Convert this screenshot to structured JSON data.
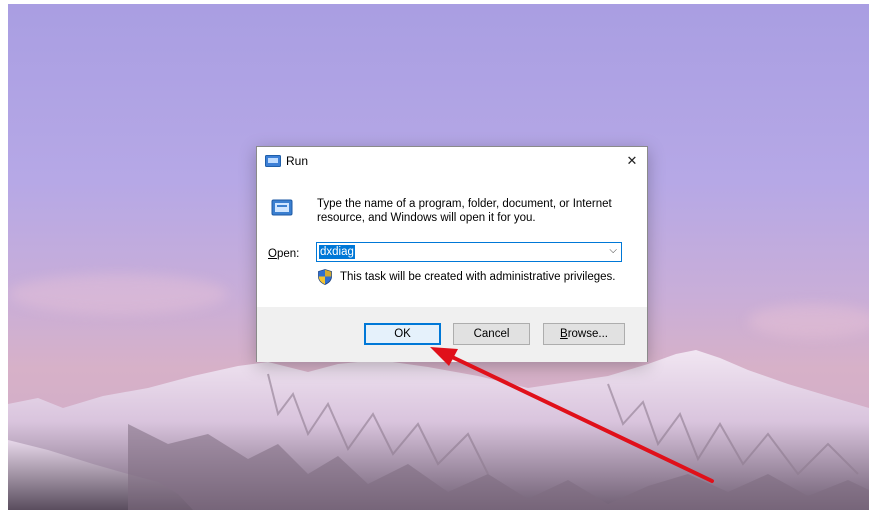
{
  "dialog": {
    "title": "Run",
    "close_glyph": "✕",
    "description_line1": "Type the name of a program, folder, document, or Internet",
    "description_line2": "resource, and Windows will open it for you.",
    "open_label_mnemonic": "O",
    "open_label_rest": "pen:",
    "input_value": "dxdiag",
    "dropdown_glyph": "⌵",
    "admin_note": "This task will be created with administrative privileges.",
    "buttons": {
      "ok": "OK",
      "cancel": "Cancel",
      "browse_mnemonic": "B",
      "browse_rest": "rowse..."
    }
  },
  "icons": [
    "run-icon",
    "run-large-icon",
    "close-icon",
    "chevron-down-icon",
    "shield-icon"
  ],
  "colors": {
    "accent": "#0078d7",
    "arrow": "#e0101a",
    "button_area": "#f0f0f0",
    "sky_top": "#a99ee2",
    "sky_horizon": "#d7b1c8"
  }
}
